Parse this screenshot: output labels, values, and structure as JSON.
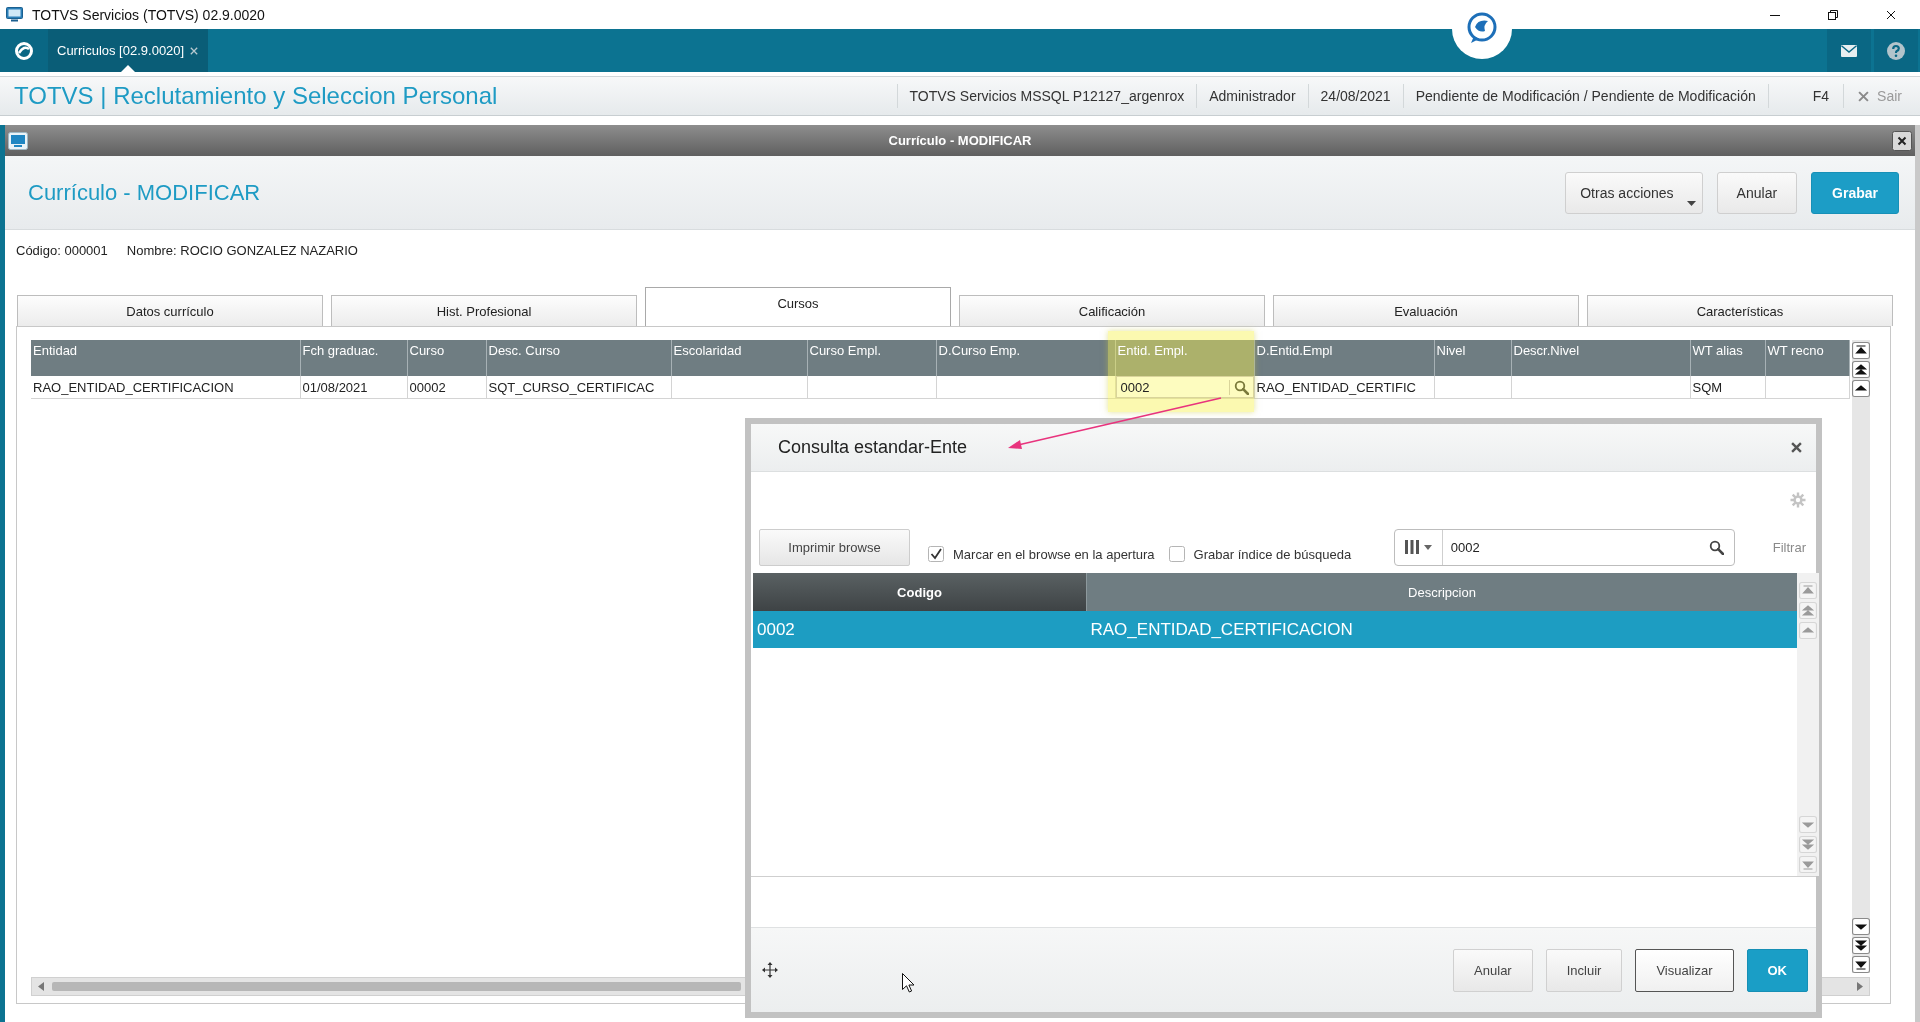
{
  "window": {
    "title": "TOTVS Servicios (TOTVS) 02.9.0020"
  },
  "top_bar": {
    "tabs": [
      {
        "label": "Curriculos [02.9.0020]",
        "selected": true
      }
    ]
  },
  "app_header": {
    "title": "TOTVS | Reclutamiento y Seleccion Personal",
    "info": [
      "TOTVS Servicios MSSQL P12127_argenrox",
      "Administrador",
      "24/08/2021",
      "Pendiente de Modificación / Pendiente de Modificación"
    ],
    "shortcut": "F4",
    "exit": "Sair"
  },
  "form": {
    "window_title": "Currículo - MODIFICAR",
    "heading": "Currículo - MODIFICAR",
    "buttons": [
      {
        "label": "Otras acciones",
        "kind": "menu"
      },
      {
        "label": "Anular",
        "kind": "default"
      },
      {
        "label": "Grabar",
        "kind": "primary"
      }
    ],
    "record": [
      "Código: 000001",
      "Nombre: ROCIO GONZALEZ NAZARIO"
    ],
    "tabs": [
      {
        "label": "Datos currículo",
        "selected": false
      },
      {
        "label": "Hist. Profesional",
        "selected": false
      },
      {
        "label": "Cursos",
        "selected": true
      },
      {
        "label": "Calificación",
        "selected": false
      },
      {
        "label": "Evaluación",
        "selected": false
      },
      {
        "label": "Características",
        "selected": false
      }
    ],
    "grid": {
      "columns": [
        "Entidad",
        "Fch graduac.",
        "Curso",
        "Desc. Curso",
        "Escolaridad",
        "Curso Empl.",
        "D.Curso Emp.",
        "Entid. Empl.",
        "D.Entid.Empl",
        "Nivel",
        "Descr.Nivel",
        "WT alias",
        "WT recno"
      ],
      "rows": [
        {
          "cells": [
            {
              "kind": "text",
              "value": "RAO_ENTIDAD_CERTIFICACION"
            },
            {
              "kind": "text",
              "value": "01/08/2021"
            },
            {
              "kind": "text",
              "value": "00002"
            },
            {
              "kind": "text",
              "value": "SQT_CURSO_CERTIFICAC"
            },
            {
              "kind": "text"
            },
            {
              "kind": "text"
            },
            {
              "kind": "text"
            },
            {
              "kind": "lookup",
              "value": "0002"
            },
            {
              "kind": "text",
              "value": "RAO_ENTIDAD_CERTIFIC"
            },
            {
              "kind": "text"
            },
            {
              "kind": "text"
            },
            {
              "kind": "text",
              "value": "SQM"
            },
            {
              "kind": "text"
            }
          ]
        }
      ]
    }
  },
  "dialog": {
    "title": "Consulta estandar-Ente",
    "print_button": "Imprimir browse",
    "options": [
      {
        "label": "Marcar en el browse en la apertura",
        "checked": true
      },
      {
        "label": "Grabar índice de búsqueda",
        "checked": false
      }
    ],
    "search": {
      "value": "0002"
    },
    "filter_link": "Filtrar",
    "columns": [
      {
        "label": "Codigo",
        "sorted": true
      },
      {
        "label": "Descripcion",
        "sorted": false
      }
    ],
    "rows": [
      {
        "cells": [
          "0002",
          "RAO_ENTIDAD_CERTIFICACION"
        ],
        "selected": true
      }
    ],
    "buttons": [
      {
        "label": "Anular",
        "kind": "default"
      },
      {
        "label": "Incluir",
        "kind": "default"
      },
      {
        "label": "Visualizar",
        "kind": "focused"
      },
      {
        "label": "OK",
        "kind": "primary"
      }
    ]
  }
}
